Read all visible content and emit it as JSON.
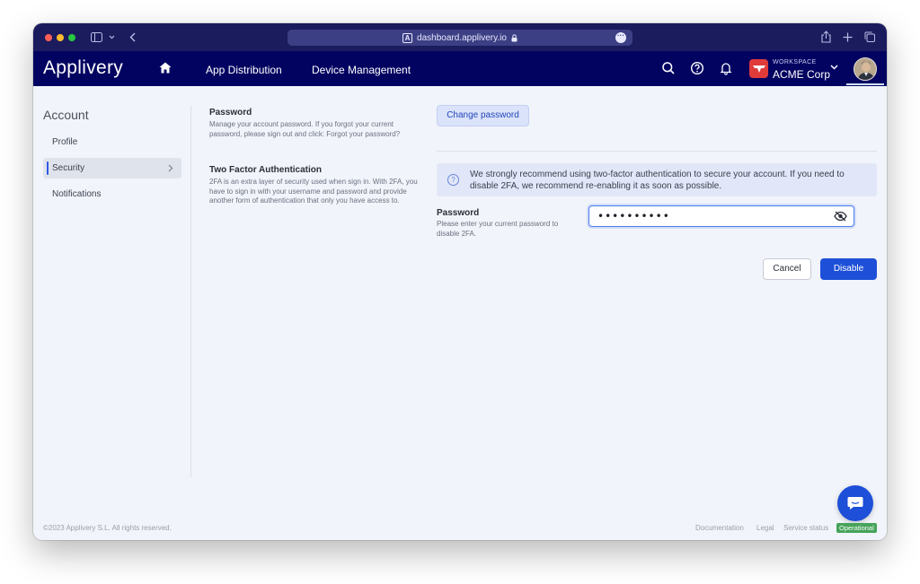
{
  "browser": {
    "url": "dashboard.applivery.io"
  },
  "header": {
    "logo": "Applivery",
    "nav": [
      "App Distribution",
      "Device Management"
    ],
    "workspace_label": "WORKSPACE",
    "workspace_name": "ACME Corp"
  },
  "sidebar": {
    "title": "Account",
    "items": [
      {
        "label": "Profile"
      },
      {
        "label": "Security"
      },
      {
        "label": "Notifications"
      }
    ]
  },
  "password_section": {
    "title": "Password",
    "description": "Manage your account password. If you forgot your current password, please sign out and click: Forgot your password?",
    "change_button": "Change password"
  },
  "twofa_section": {
    "title": "Two Factor Authentication",
    "description": "2FA is an extra layer of security used when sign in. With 2FA, you have to sign in with your username and password and provide another form of authentication that only you have access to.",
    "info": "We strongly recommend using two-factor authentication to secure your account. If you need to disable 2FA, we recommend re-enabling it as soon as possible.",
    "password_label": "Password",
    "password_hint": "Please enter your current password to disable 2FA.",
    "password_value": "••••••••••",
    "cancel_label": "Cancel",
    "disable_label": "Disable"
  },
  "footer": {
    "copyright": "©2023 Applivery S.L. All rights reserved.",
    "links": [
      "Documentation",
      "Legal",
      "Service status"
    ],
    "status": "Operational"
  },
  "colors": {
    "header_bg": "#020361",
    "primary": "#1d4fd8",
    "page_bg": "#f1f4fa",
    "status_green": "#46a35a"
  }
}
